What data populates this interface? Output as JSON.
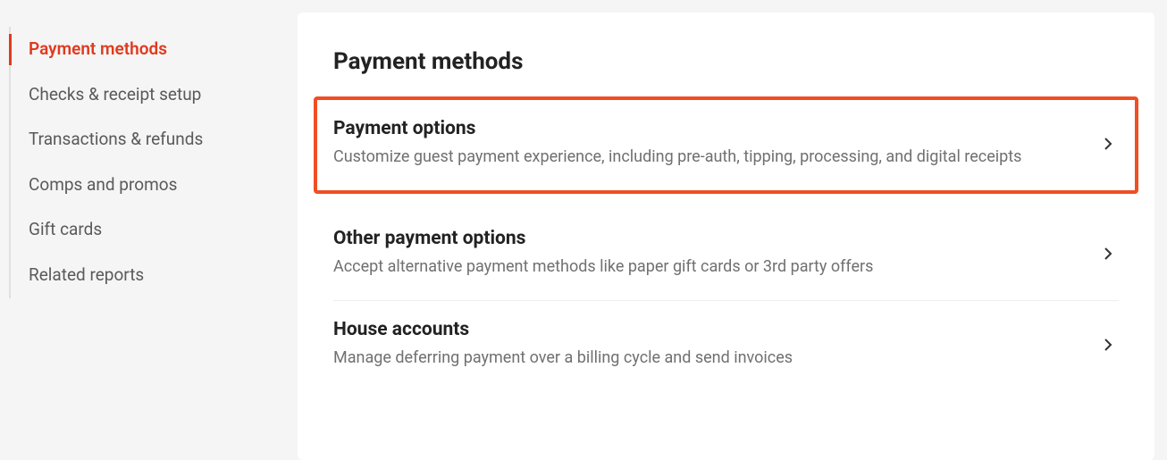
{
  "sidebar": {
    "items": [
      {
        "label": "Payment methods",
        "active": true
      },
      {
        "label": "Checks & receipt setup",
        "active": false
      },
      {
        "label": "Transactions & refunds",
        "active": false
      },
      {
        "label": "Comps and promos",
        "active": false
      },
      {
        "label": "Gift cards",
        "active": false
      },
      {
        "label": "Related reports",
        "active": false
      }
    ]
  },
  "main": {
    "title": "Payment methods",
    "sections": [
      {
        "title": "Payment options",
        "desc": "Customize guest payment experience, including pre-auth, tipping, processing, and digital receipts",
        "highlighted": true
      },
      {
        "title": "Other payment options",
        "desc": "Accept alternative payment methods like paper gift cards or 3rd party offers",
        "highlighted": false
      },
      {
        "title": "House accounts",
        "desc": "Manage deferring payment over a billing cycle and send invoices",
        "highlighted": false
      }
    ]
  }
}
